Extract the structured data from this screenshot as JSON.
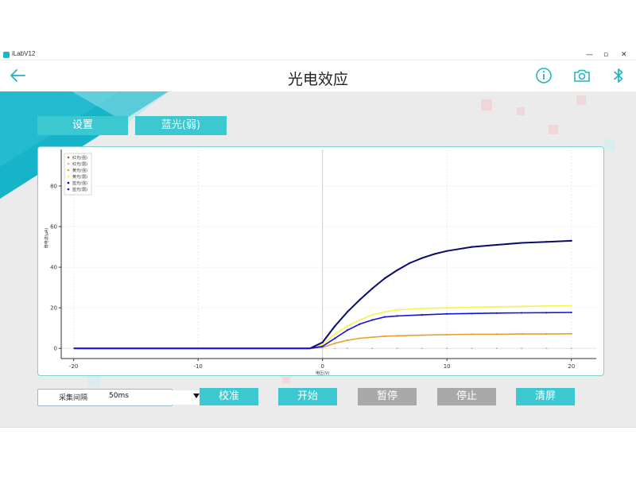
{
  "window": {
    "app_name": "iLabV12",
    "minimize": "—",
    "maximize": "▫",
    "close": "✕"
  },
  "header": {
    "title": "光电效应",
    "back_icon": "arrow-left-icon",
    "icons": [
      "info-icon",
      "camera-icon",
      "bluetooth-icon"
    ]
  },
  "tabs": {
    "settings_label": "设置",
    "light_label": "蓝光(弱)"
  },
  "controls": {
    "interval_label": "采集间隔",
    "interval_value": "50ms",
    "calibrate_label": "校准",
    "start_label": "开始",
    "pause_label": "暂停",
    "stop_label": "停止",
    "clear_label": "清屏"
  },
  "colors": {
    "accent": "#3cc8d0",
    "disabled": "#a9a9a9",
    "panel_border": "#7fd1d6",
    "banner": "#17b4c9"
  },
  "chart_data": {
    "type": "scatter",
    "xlabel": "电压(V)",
    "ylabel": "微电流(μA)",
    "xlim": [
      -21,
      22
    ],
    "ylim": [
      -5,
      98
    ],
    "x_ticks": [
      -20,
      -10,
      0,
      10,
      20
    ],
    "y_ticks": [
      0,
      20,
      40,
      60,
      80
    ],
    "x_tick_labels": [
      "-20",
      "-10",
      "0",
      "10",
      "20"
    ],
    "y_tick_labels": [
      "0",
      "20",
      "40",
      "60",
      "80"
    ],
    "grid": true,
    "legend_position": "top-left",
    "series": [
      {
        "name": "红光(强)",
        "color": "#e8403a",
        "x": [
          1,
          2,
          4,
          6,
          8,
          10,
          12,
          14,
          16,
          18,
          20
        ],
        "y": [
          0,
          0,
          0,
          0,
          0,
          0,
          0,
          0,
          0,
          0,
          0
        ]
      },
      {
        "name": "红光(弱)",
        "color": "#f5a3a3",
        "x": [
          1,
          2,
          4,
          6,
          8,
          10,
          12,
          14,
          16,
          18,
          20
        ],
        "y": [
          0,
          0,
          0,
          0,
          0,
          0,
          0,
          0,
          0,
          0,
          0
        ]
      },
      {
        "name": "黄光(强)",
        "color": "#e8a030",
        "x": [
          -20,
          -1,
          0,
          1,
          2,
          3,
          4,
          5,
          6,
          8,
          10,
          12,
          14,
          16,
          18,
          20
        ],
        "y": [
          0,
          0,
          0.5,
          2.5,
          4,
          5,
          5.5,
          6,
          6.2,
          6.5,
          6.8,
          7,
          7,
          7.1,
          7.1,
          7.2
        ]
      },
      {
        "name": "黄光(弱)",
        "color": "#f5f548",
        "x": [
          -20,
          -1,
          0,
          1,
          2,
          3,
          4,
          5,
          6,
          8,
          10,
          12,
          14,
          16,
          18,
          20
        ],
        "y": [
          0,
          0,
          2,
          7,
          11,
          14,
          16.5,
          18,
          19,
          19.6,
          20,
          20.3,
          20.5,
          20.7,
          20.9,
          21
        ]
      },
      {
        "name": "蓝光(强)",
        "color": "#0a0a6e",
        "x": [
          -20,
          -1,
          0,
          1,
          2,
          3,
          4,
          5,
          6,
          7,
          8,
          9,
          10,
          12,
          14,
          16,
          18,
          20
        ],
        "y": [
          0,
          0,
          3,
          11,
          18,
          24,
          29.5,
          34.5,
          38.5,
          42,
          44.5,
          46.5,
          48,
          50,
          51,
          52,
          52.5,
          53
        ]
      },
      {
        "name": "蓝光(弱)",
        "color": "#1414d8",
        "x": [
          -20,
          -1,
          0,
          1,
          2,
          3,
          4,
          5,
          6,
          8,
          10,
          12,
          14,
          16,
          18,
          20
        ],
        "y": [
          0,
          0,
          1,
          5,
          9,
          12,
          14,
          15.5,
          16,
          16.5,
          17,
          17.2,
          17.4,
          17.5,
          17.6,
          17.7
        ]
      }
    ]
  }
}
